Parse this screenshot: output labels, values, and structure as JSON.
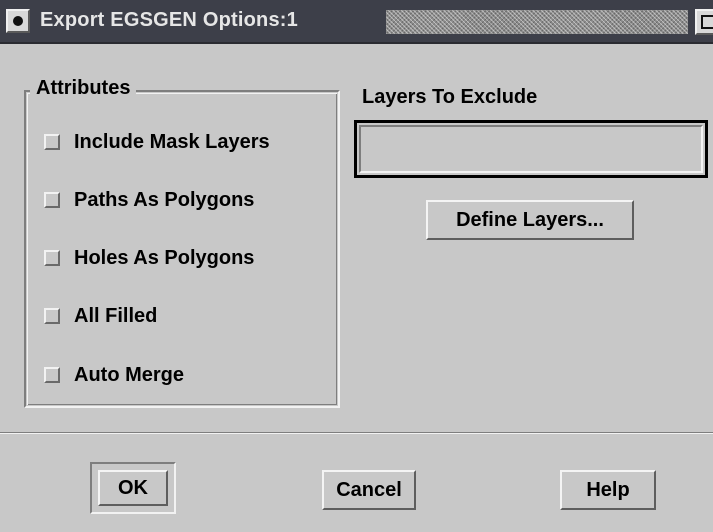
{
  "window": {
    "title": "Export EGSGEN Options:1"
  },
  "attributes": {
    "group_title": "Attributes",
    "options": [
      {
        "label": "Include Mask Layers",
        "checked": false
      },
      {
        "label": "Paths As Polygons",
        "checked": false
      },
      {
        "label": "Holes As Polygons",
        "checked": false
      },
      {
        "label": "All Filled",
        "checked": false
      },
      {
        "label": "Auto Merge",
        "checked": false
      }
    ]
  },
  "layers": {
    "label": "Layers To Exclude",
    "value": "",
    "define_button": "Define Layers..."
  },
  "footer": {
    "ok_label": "OK",
    "cancel_label": "Cancel",
    "help_label": "Help"
  },
  "icons": {
    "window_menu": "window-menu-icon",
    "maximize": "maximize-icon"
  },
  "colors": {
    "dialog_bg": "#c8c8c8",
    "titlebar_bg": "#3d3f49",
    "title_text": "#e6e6e6"
  }
}
